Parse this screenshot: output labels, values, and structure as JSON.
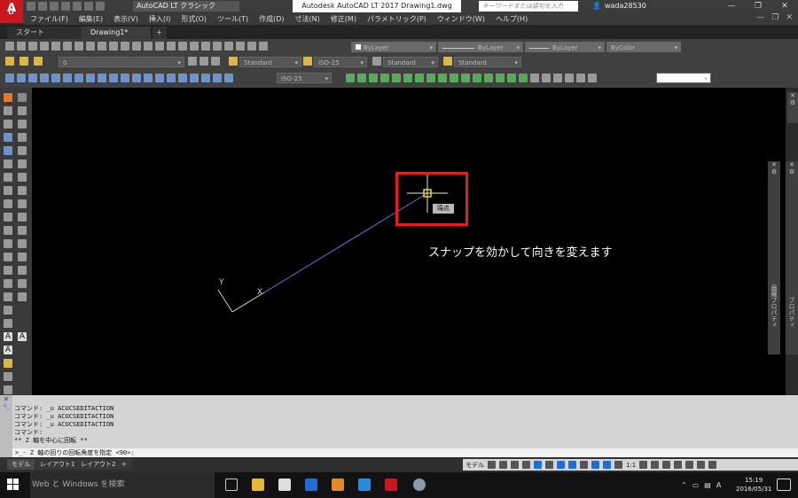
{
  "app": {
    "logo_letter": "A",
    "logo_sub": "LT",
    "workspace": "AutoCAD LT クラシック",
    "title": "Autodesk AutoCAD LT 2017   Drawing1.dwg",
    "search_placeholder": "キーワードまたは語句を入力",
    "user": "wada28530",
    "window_controls": [
      "—",
      "❐",
      "✕"
    ]
  },
  "menu": {
    "items": [
      "ファイル(F)",
      "編集(E)",
      "表示(V)",
      "挿入(I)",
      "形式(O)",
      "ツール(T)",
      "作成(D)",
      "寸法(N)",
      "修正(M)",
      "パラメトリック(P)",
      "ウィンドウ(W)",
      "ヘルプ(H)"
    ],
    "controls": [
      "—",
      "❐",
      "✕"
    ]
  },
  "file_tabs": {
    "start": "スタート",
    "drawing": "Drawing1*",
    "plus": "+"
  },
  "properties": {
    "color": "ByLayer",
    "linetype": "ByLayer",
    "lineweight": "ByLayer",
    "plotstyle": "ByColor"
  },
  "layer": {
    "current": "0"
  },
  "styles": {
    "text": "Standard",
    "dim": "ISO-25",
    "table": "Standard",
    "mleader": "Standard",
    "dim2": "ISO-25"
  },
  "canvas": {
    "snap_label": "端点",
    "annotation": "スナップを効かして向きを変えます",
    "ucs_y": "Y",
    "ucs_x": "X"
  },
  "right_palettes": {
    "properties_label": "プロパティ",
    "layer_label": "画層プロパティ"
  },
  "command": {
    "history": [
      "コマンド: _u ACUCSEDITACTION",
      "コマンド: _u ACUCSEDITACTION",
      "コマンド: _u ACUCSEDITACTION",
      "コマンド:",
      "** Z 軸を中心に回転 **"
    ],
    "prompt": ">_- Z 軸の回りの回転角度を指定 <90>:"
  },
  "layout_tabs": [
    "モデル",
    "レイアウト1",
    "レイアウト2",
    "+"
  ],
  "status": {
    "model": "モデル",
    "scale": "1:1"
  },
  "taskbar": {
    "search": "Web と Windows を検索",
    "time": "15:19",
    "date": "2016/05/31",
    "ime": "A"
  },
  "colors": {
    "accent_red": "#c8171e",
    "crosshair_line": "#6d73d6",
    "snap_marker": "#f0e000",
    "frame_red": "#e02020"
  }
}
